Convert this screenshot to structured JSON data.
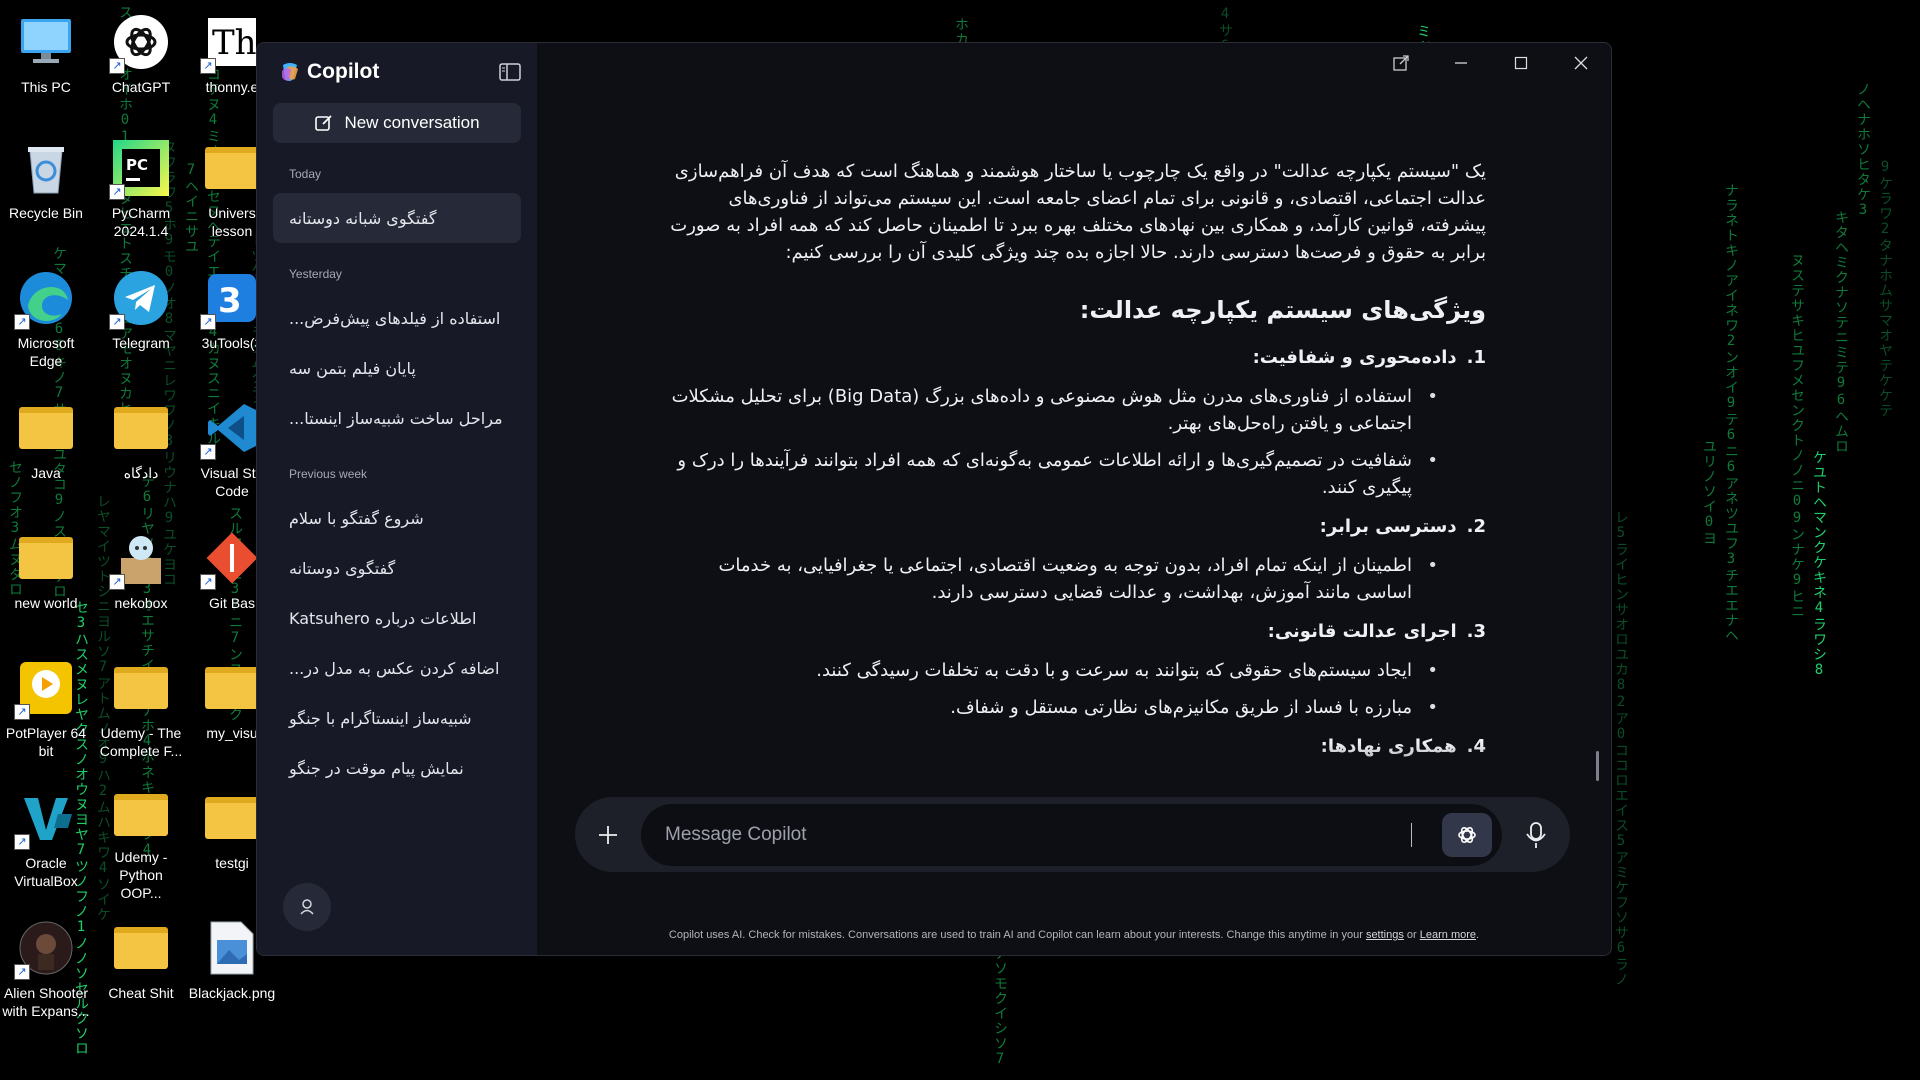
{
  "desktop": {
    "icons": [
      {
        "label": "This PC",
        "icon": "monitor-icon"
      },
      {
        "label": "ChatGPT",
        "icon": "chatgpt-icon"
      },
      {
        "label": "thonny.e",
        "icon": "thonny-icon"
      },
      {
        "label": "Recycle Bin",
        "icon": "recycle-bin-icon"
      },
      {
        "label": "PyCharm 2024.1.4",
        "icon": "pycharm-icon"
      },
      {
        "label": "Univers lesson",
        "icon": "folder-icon"
      },
      {
        "label": "Microsoft Edge",
        "icon": "edge-icon"
      },
      {
        "label": "Telegram",
        "icon": "telegram-icon"
      },
      {
        "label": "3uTools(3",
        "icon": "3utools-icon"
      },
      {
        "label": "Java",
        "icon": "folder-icon"
      },
      {
        "label": "دادگاه",
        "icon": "folder-icon"
      },
      {
        "label": "Visual Stu Code",
        "icon": "vscode-icon"
      },
      {
        "label": "new world",
        "icon": "folder-icon"
      },
      {
        "label": "nekobox",
        "icon": "nekobox-icon"
      },
      {
        "label": "Git Bas",
        "icon": "git-icon"
      },
      {
        "label": "PotPlayer 64 bit",
        "icon": "potplayer-icon"
      },
      {
        "label": "Udemy - The Complete F...",
        "icon": "folder-icon"
      },
      {
        "label": "my_visu",
        "icon": "folder-icon"
      },
      {
        "label": "Oracle VirtualBox",
        "icon": "virtualbox-icon"
      },
      {
        "label": "Udemy - Python OOP...",
        "icon": "folder-icon"
      },
      {
        "label": "testgi",
        "icon": "folder-icon"
      },
      {
        "label": "Alien Shooter with Expans...",
        "icon": "alien-shooter-icon"
      },
      {
        "label": "Cheat Shit",
        "icon": "folder-icon"
      },
      {
        "label": "Blackjack.png",
        "icon": "image-file-icon"
      }
    ],
    "wallpaper_color": "#0f7a3a"
  },
  "copilot": {
    "brand": "Copilot",
    "new_conversation": "New conversation",
    "sections": [
      {
        "title": "Today",
        "items": [
          "گفتگوی شبانه دوستانه"
        ]
      },
      {
        "title": "Yesterday",
        "items": [
          "استفاده از فیلدهای پیش‌فرض...",
          "پایان فیلم بتمن سه",
          "مراحل ساخت شبیه‌ساز اینستا..."
        ]
      },
      {
        "title": "Previous week",
        "items": [
          "شروع گفتگو با سلام",
          "گفتگوی دوستانه",
          "اطلاعات درباره Katsuhero",
          "اضافه کردن عکس به مدل در...",
          "شبیه‌ساز اینستاگرام با جنگو",
          "نمایش پیام موقت در جنگو"
        ]
      }
    ],
    "answer": {
      "intro": "یک \"سیستم یکپارچه عدالت\" در واقع یک چارچوب یا ساختار هوشمند و هماهنگ است که هدف آن فراهم‌سازی عدالت اجتماعی، اقتصادی، و قانونی برای تمام اعضای جامعه است. این سیستم می‌تواند از فناوری‌های پیشرفته، قوانین کارآمد، و همکاری بین نهادهای مختلف بهره ببرد تا اطمینان حاصل کند که همه افراد به صورت برابر به حقوق و فرصت‌ها دسترسی دارند. حالا اجازه بده چند ویژگی کلیدی آن را بررسی کنیم:",
      "heading": "ویژگی‌های سیستم یکپارچه عدالت:",
      "points": [
        {
          "num": "1.",
          "title": "داده‌محوری و شفافیت:",
          "bullets": [
            "استفاده از فناوری‌های مدرن مثل هوش مصنوعی و داده‌های بزرگ (Big Data) برای تحلیل مشکلات اجتماعی و یافتن راه‌حل‌های بهتر.",
            "شفافیت در تصمیم‌گیری‌ها و ارائه اطلاعات عمومی به‌گونه‌ای که همه افراد بتوانند فرآیندها را درک و پیگیری کنند."
          ]
        },
        {
          "num": "2.",
          "title": "دسترسی برابر:",
          "bullets": [
            "اطمینان از اینکه تمام افراد، بدون توجه به وضعیت اقتصادی، اجتماعی یا جغرافیایی، به خدمات اساسی مانند آموزش، بهداشت، و عدالت قضایی دسترسی دارند."
          ]
        },
        {
          "num": "3.",
          "title": "اجرای عدالت قانونی:",
          "bullets": [
            "ایجاد سیستم‌های حقوقی که بتوانند به سرعت و با دقت به تخلفات رسیدگی کنند.",
            "مبارزه با فساد از طریق مکانیزم‌های نظارتی مستقل و شفاف."
          ]
        },
        {
          "num": "4.",
          "title": "همکاری نهادها:",
          "bullets": []
        }
      ]
    },
    "composer": {
      "placeholder": "Message Copilot"
    },
    "disclaimer": {
      "text": "Copilot uses AI. Check for mistakes. Conversations are used to train AI and Copilot can learn about your interests. Change this anytime in your",
      "settings_link": "settings",
      "or": "or",
      "learn_more_link": "Learn more",
      "end": "."
    }
  }
}
